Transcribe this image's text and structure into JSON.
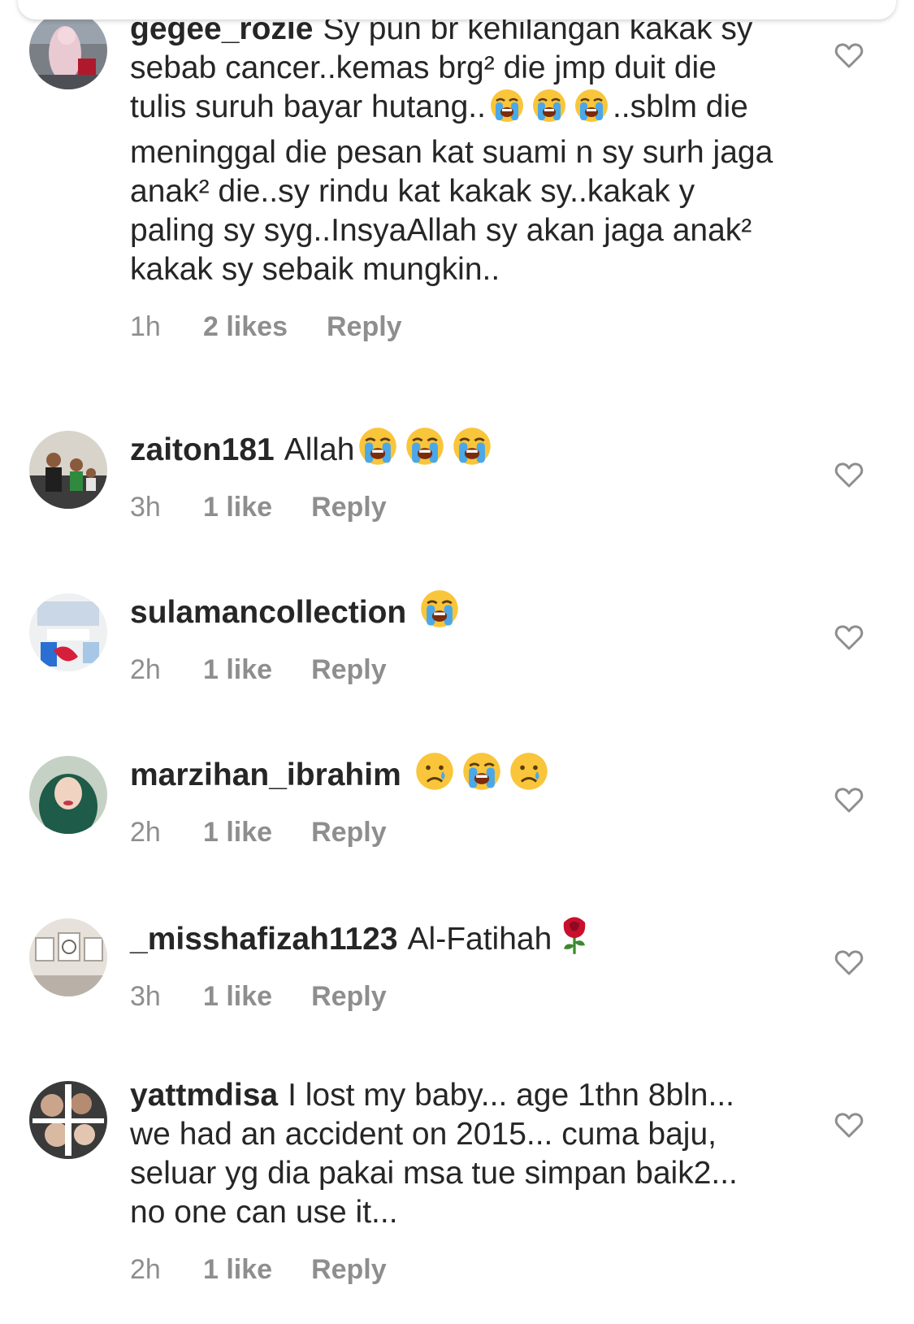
{
  "comments": [
    {
      "username": "gegee_rozie",
      "segments": [
        {
          "t": "Sy pun br kehilangan kakak sy sebab cancer..kemas brg² die jmp duit die tulis suruh bayar hutang.."
        },
        {
          "e": "loudly-crying-face"
        },
        {
          "e": "loudly-crying-face"
        },
        {
          "e": "loudly-crying-face"
        },
        {
          "t": "..sblm die meninggal die pesan kat suami n sy surh jaga anak² die..sy rindu kat kakak sy..kakak y paling sy syg..InsyaAllah sy akan jaga anak² kakak sy sebaik mungkin.."
        }
      ],
      "time": "1h",
      "likes": "2 likes",
      "reply": "Reply",
      "avatar": "pink-hijab-avatar"
    },
    {
      "username": "zaiton181",
      "segments": [
        {
          "t": "Allah"
        },
        {
          "e": "loudly-crying-face"
        },
        {
          "e": "loudly-crying-face"
        },
        {
          "e": "loudly-crying-face"
        }
      ],
      "time": "3h",
      "likes": "1 like",
      "reply": "Reply",
      "avatar": "family-photo-avatar"
    },
    {
      "username": "sulamancollection",
      "segments": [
        {
          "e": "loudly-crying-face"
        }
      ],
      "time": "2h",
      "likes": "1 like",
      "reply": "Reply",
      "avatar": "collection-logo-avatar"
    },
    {
      "username": "marzihan_ibrahim",
      "segments": [
        {
          "e": "crying-face"
        },
        {
          "e": "loudly-crying-face"
        },
        {
          "e": "crying-face"
        }
      ],
      "time": "2h",
      "likes": "1 like",
      "reply": "Reply",
      "avatar": "hijab-selfie-avatar"
    },
    {
      "username": "_misshafizah1123",
      "segments": [
        {
          "t": "Al-Fatihah"
        },
        {
          "e": "rose"
        }
      ],
      "time": "3h",
      "likes": "1 like",
      "reply": "Reply",
      "avatar": "calligraphy-frames-avatar"
    },
    {
      "username": "yattmdisa",
      "segments": [
        {
          "t": "I lost my baby... age 1thn 8bln... we had an accident on 2015... cuma baju, seluar yg dia pakai msa tue simpan baik2... no one can use it..."
        }
      ],
      "time": "2h",
      "likes": "1 like",
      "reply": "Reply",
      "avatar": "family-collage-avatar"
    }
  ],
  "colors": {
    "text": "#262626",
    "muted": "#8e8e8e",
    "heart_stroke": "#8e8e8e"
  }
}
